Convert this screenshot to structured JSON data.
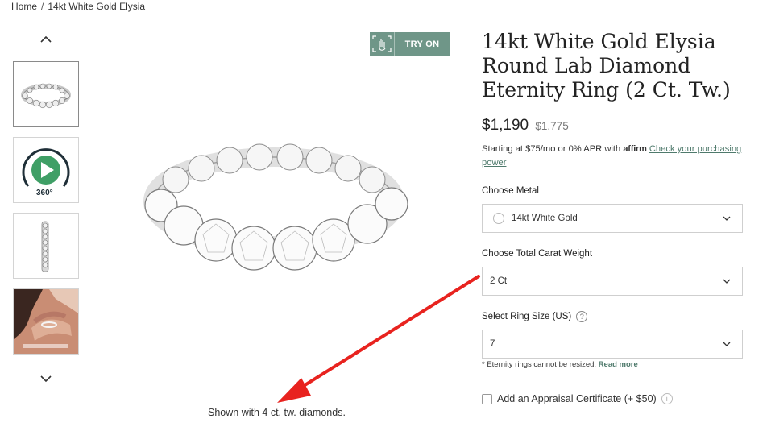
{
  "breadcrumb": {
    "home": "Home",
    "separator": "/",
    "current": "14kt White Gold Elysia"
  },
  "thumbnails": [
    {
      "kind": "ring-flat"
    },
    {
      "kind": "video-360",
      "label": "360°"
    },
    {
      "kind": "ring-side"
    },
    {
      "kind": "lifestyle-hand"
    }
  ],
  "try_on": {
    "label": "TRY ON",
    "icon": "hand-ar-icon"
  },
  "product": {
    "title": "14kt White Gold Elysia Round Lab Diamond Eternity Ring (2 Ct. Tw.)",
    "price": "$1,190",
    "original_price": "$1,775"
  },
  "financing": {
    "text": "Starting at $75/mo or 0% APR with",
    "brand": "affirm",
    "link": "Check your purchasing power"
  },
  "options": {
    "metal": {
      "label": "Choose Metal",
      "value": "14kt White Gold"
    },
    "carat": {
      "label": "Choose Total Carat Weight",
      "value": "2 Ct"
    },
    "size": {
      "label": "Select Ring Size (US)",
      "help": "?",
      "value": "7"
    }
  },
  "note": {
    "text": "* Eternity rings cannot be resized.",
    "link": "Read more"
  },
  "appraisal": {
    "label": "Add an Appraisal Certificate (+ $50)",
    "info": "i"
  },
  "caption": "Shown with 4 ct. tw. diamonds.",
  "colors": {
    "accent": "#6f9688",
    "link": "#4f7a6c",
    "annotation_arrow": "#e8231f"
  }
}
